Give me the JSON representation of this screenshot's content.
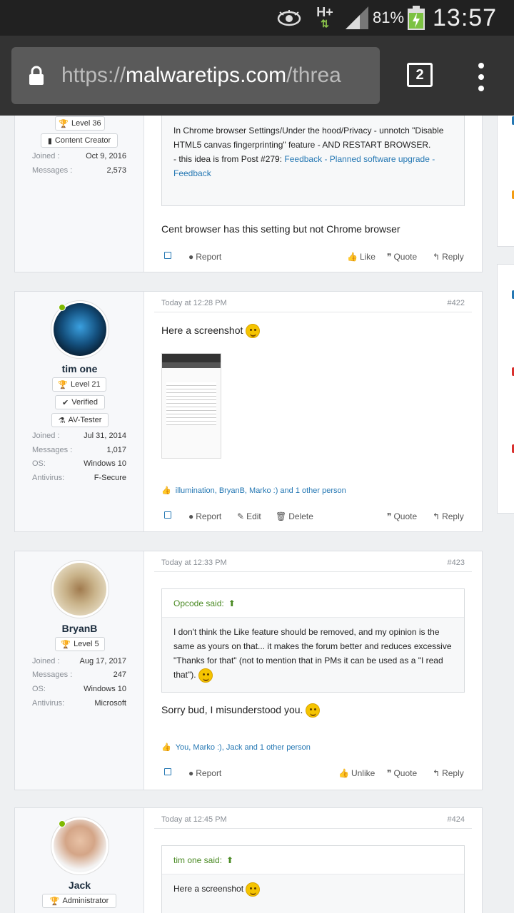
{
  "status_bar": {
    "battery": "81%",
    "time": "13:57",
    "network": "H+"
  },
  "browser": {
    "url_prefix": "https://",
    "url_domain": "malwaretips.com",
    "url_suffix": "/threa",
    "tab_count": "2"
  },
  "posts": [
    {
      "user": {
        "level": "Level 36",
        "title": "Content Creator",
        "joined_k": "Joined :",
        "joined_v": "Oct 9, 2016",
        "messages_k": "Messages :",
        "messages_v": "2,573"
      },
      "quote_body": "In Chrome browser Settings/Under the hood/Privacy - unnotch \"Disable HTML5 canvas fingerprinting\" feature - AND RESTART BROWSER.",
      "quote_body2": "- this idea is from Post #279: ",
      "quote_link": "Feedback - Planned software upgrade - Feedback",
      "text": "Cent browser has this setting but not Chrome browser",
      "actions": {
        "report": "Report",
        "like": "Like",
        "quote": "Quote",
        "reply": "Reply"
      }
    },
    {
      "user": {
        "name": "tim one",
        "level": "Level 21",
        "verified": "Verified",
        "tester": "AV-Tester",
        "joined_k": "Joined :",
        "joined_v": "Jul 31, 2014",
        "messages_k": "Messages :",
        "messages_v": "1,017",
        "os_k": "OS:",
        "os_v": "Windows 10",
        "av_k": "Antivirus:",
        "av_v": "F-Secure"
      },
      "time": "Today at 12:28 PM",
      "num": "#422",
      "text": "Here a screenshot",
      "likes": "illumination, BryanB, Marko :) and 1 other person",
      "actions": {
        "report": "Report",
        "edit": "Edit",
        "delete": "Delete",
        "quote": "Quote",
        "reply": "Reply"
      }
    },
    {
      "user": {
        "name": "BryanB",
        "level": "Level 5",
        "joined_k": "Joined :",
        "joined_v": "Aug 17, 2017",
        "messages_k": "Messages :",
        "messages_v": "247",
        "os_k": "OS:",
        "os_v": "Windows 10",
        "av_k": "Antivirus:",
        "av_v": "Microsoft"
      },
      "time": "Today at 12:33 PM",
      "num": "#423",
      "quote_head": "Opcode said:",
      "quote_body": "I don't think the Like feature should be removed, and my opinion is the same as yours on that... it makes the forum better and reduces excessive \"Thanks for that\" (not to mention that in PMs it can be used as a \"I read that\").",
      "text": "Sorry bud, I misunderstood you.",
      "likes": "You, Marko :), Jack and 1 other person",
      "actions": {
        "report": "Report",
        "unlike": "Unlike",
        "quote": "Quote",
        "reply": "Reply"
      }
    },
    {
      "user": {
        "name": "Jack",
        "role": "Administrator"
      },
      "time": "Today at 12:45 PM",
      "num": "#424",
      "quote_head": "tim one said:",
      "quote_body": "Here a screenshot"
    }
  ],
  "colors": {
    "link": "#2477b3",
    "quote_head": "#4a8a23",
    "online": "#7fb900"
  }
}
